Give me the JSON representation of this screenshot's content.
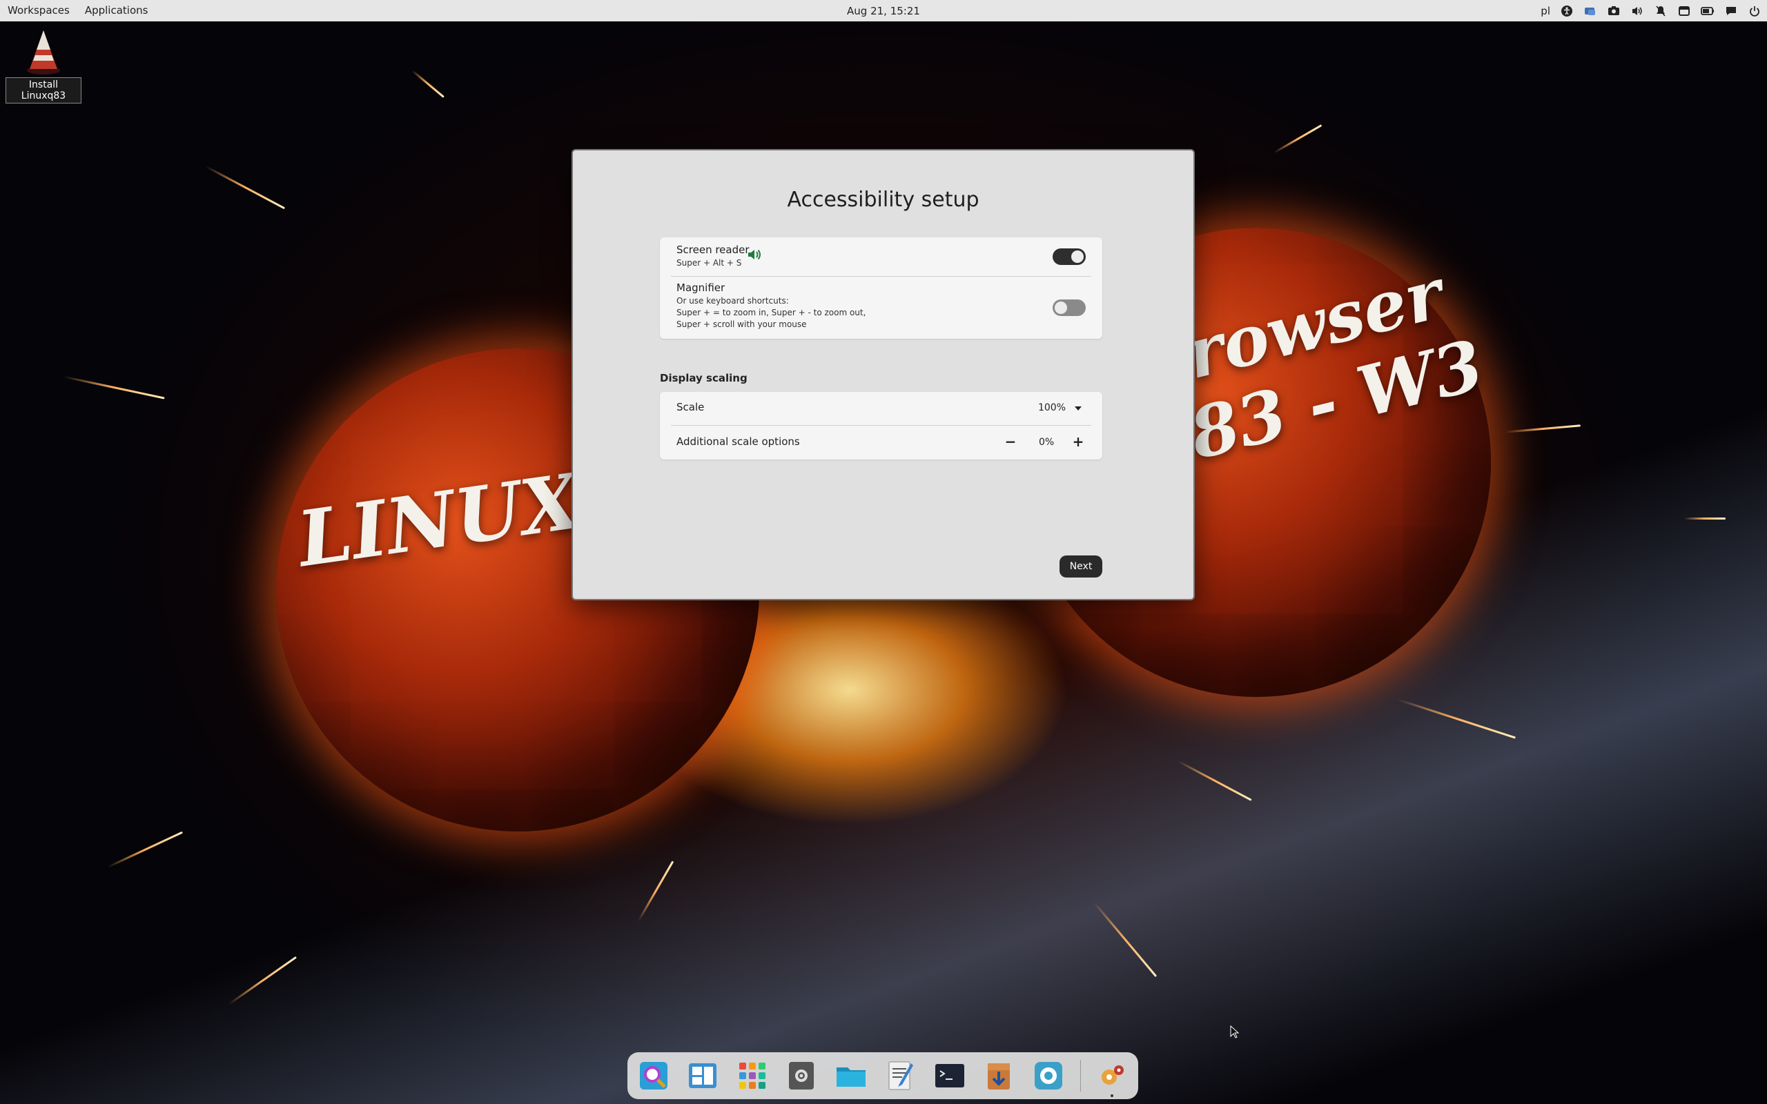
{
  "topbar": {
    "workspaces_label": "Workspaces",
    "applications_label": "Applications",
    "clock": "Aug 21, 15:21",
    "keyboard_layout": "pl"
  },
  "wallpaper": {
    "left_text": "LINUX Q",
    "right_text_line1": "rowser",
    "right_text_line2": "83 - W3"
  },
  "desktop": {
    "install_icon_label": "Install Linuxq83"
  },
  "dialog": {
    "title": "Accessibility setup",
    "screen_reader": {
      "title": "Screen reader",
      "shortcut": "Super + Alt + S",
      "enabled": true
    },
    "magnifier": {
      "title": "Magnifier",
      "line1": "Or use keyboard shortcuts:",
      "line2": "Super + = to zoom in, Super + - to zoom out,",
      "line3": "Super + scroll with your mouse",
      "enabled": false
    },
    "display_scaling": {
      "section_label": "Display scaling",
      "scale_label": "Scale",
      "scale_value": "100%",
      "additional_label": "Additional scale options",
      "additional_value": "0%",
      "minus_label": "−",
      "plus_label": "+"
    },
    "next_label": "Next"
  },
  "dock": {
    "apps": [
      "search-app",
      "workspaces-app",
      "app-grid",
      "settings",
      "files",
      "text-editor",
      "terminal",
      "software-installer",
      "screen-recorder",
      "installer-setup"
    ]
  },
  "colors": {
    "topbar_bg": "#e6e6e6",
    "dialog_bg": "#e0e0e0",
    "card_bg": "#f5f5f5",
    "toggle_on": "#2e2e2e",
    "speaker_green": "#1e7d3e"
  }
}
